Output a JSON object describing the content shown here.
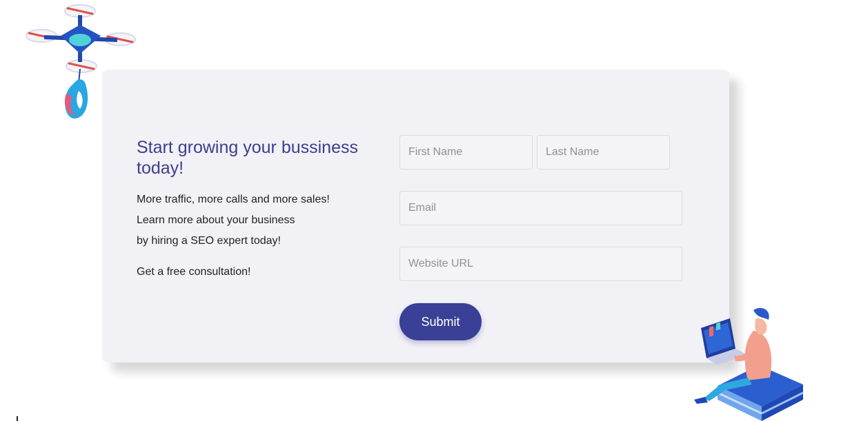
{
  "hero": {
    "headline": "Start growing your bussiness today!",
    "lines": [
      "More traffic, more calls and more sales!",
      "Learn more about your business",
      "by hiring a SEO expert today!"
    ],
    "cta": "Get a free consultation!"
  },
  "form": {
    "first_name_placeholder": "First Name",
    "last_name_placeholder": "Last Name",
    "email_placeholder": "Email",
    "website_placeholder": "Website URL",
    "submit_label": "Submit"
  },
  "illustrations": {
    "drone_icon": "drone-icon",
    "person_icon": "person-laptop-icon"
  },
  "colors": {
    "accent": "#394096",
    "headline": "#3a3f8e",
    "card_bg": "#f2f1f6"
  }
}
